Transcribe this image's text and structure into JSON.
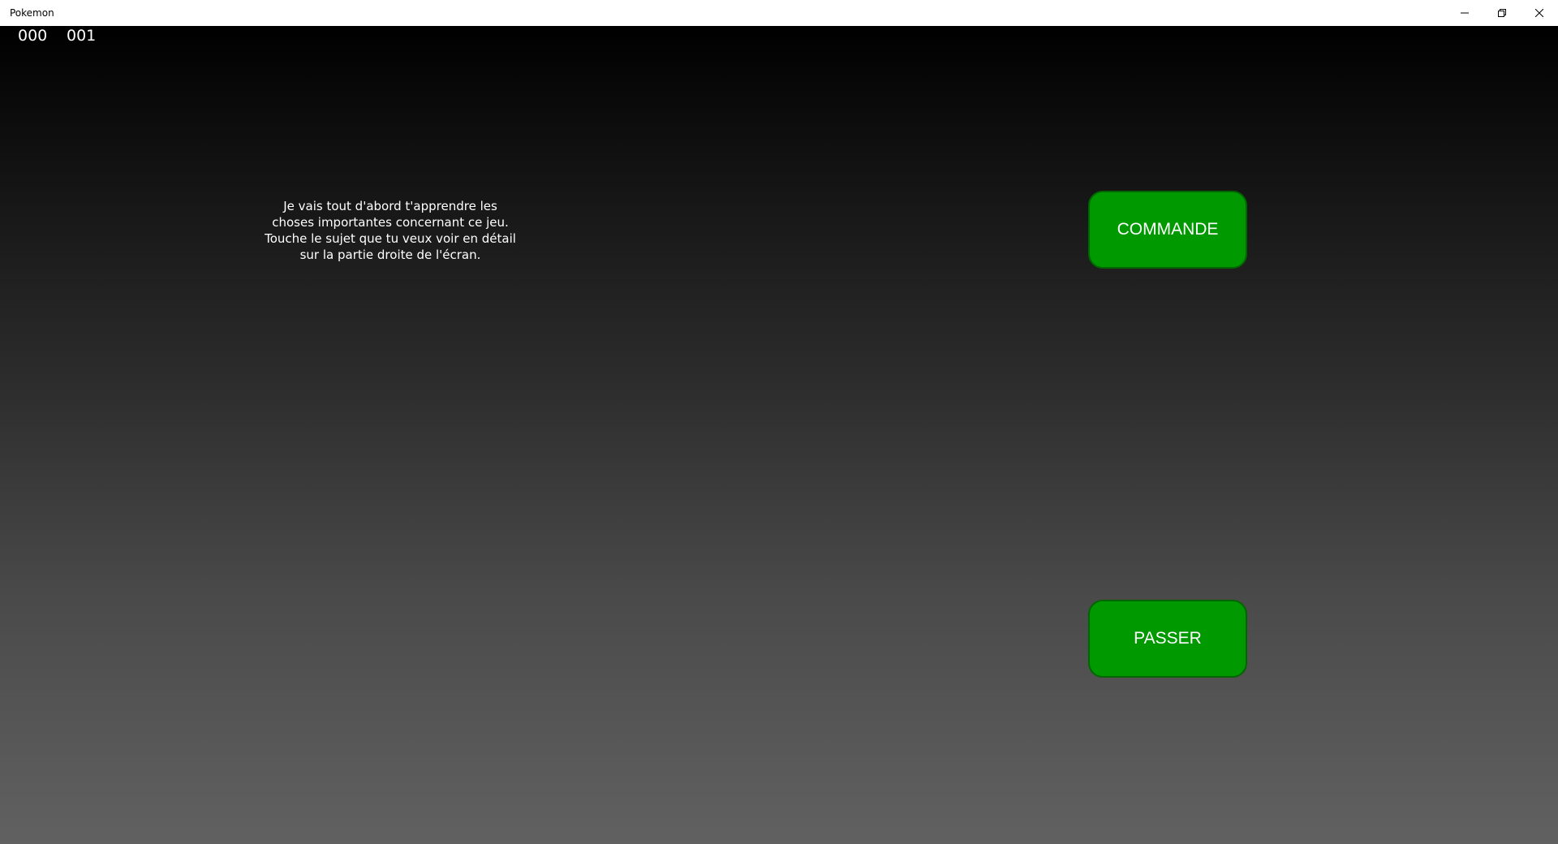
{
  "window": {
    "title": "Pokemon",
    "controls": {
      "minimize_icon": "minimize-icon",
      "restore_icon": "restore-icon",
      "close_icon": "close-icon"
    }
  },
  "hud": {
    "counter_left": "000",
    "counter_right": "001"
  },
  "tutorial": {
    "intro_text": "Je vais tout d'abord t'apprendre les choses importantes concernant ce jeu. Touche le sujet que tu veux voir en détail sur la partie droite de l'écran."
  },
  "buttons": {
    "commande_label": "COMMANDE",
    "passer_label": "PASSER"
  },
  "colors": {
    "button_fill": "#009900",
    "button_border": "#006600",
    "text": "#ffffff"
  }
}
